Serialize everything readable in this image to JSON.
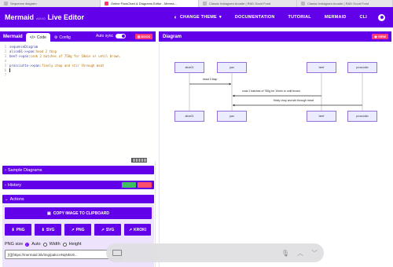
{
  "browser_tabs": [
    {
      "label": "Sequence diagram",
      "active": false
    },
    {
      "label": "Online FlowChart & Diagrams Editor - Merma...",
      "active": true
    },
    {
      "label": "Classic Instagram Arcade | RAD Good Fond",
      "active": false
    },
    {
      "label": "Classic Instagram Arcade | RAD Good Fond",
      "active": false
    }
  ],
  "header": {
    "brand": "Mermaid",
    "version": "v10.0.0",
    "brand_suffix": "Live Editor",
    "nav": [
      "CHANGE THEME",
      "DOCUMENTATION",
      "TUTORIAL",
      "MERMAID",
      "CLI"
    ]
  },
  "editor": {
    "title": "Mermaid",
    "tab_code": "Code",
    "tab_config": "Config",
    "auto_sync_label": "Auto sync",
    "docs_label": "DOCS",
    "lines": [
      {
        "num": "1",
        "kw": "sequenceDiagram",
        "text": ""
      },
      {
        "num": "2",
        "kw": "alice01->>pan:",
        "text": " head 2 tbsp"
      },
      {
        "num": "3",
        "kw": "beef->>pan:",
        "text": " cook 2 batches of 750g for 10min or until brown."
      },
      {
        "num": "4",
        "kw": "",
        "text": ""
      },
      {
        "num": "5",
        "kw": "prosciutto->>pan:",
        "text": " finely chop and stir through meat"
      },
      {
        "num": "6",
        "kw": "",
        "text": ""
      },
      {
        "num": "7",
        "kw": "",
        "text": ""
      }
    ]
  },
  "sections": {
    "samples": "Sample Diagrams",
    "history": "History",
    "actions": "Actions"
  },
  "actions": {
    "copy_image": "COPY IMAGE TO CLIPBOARD",
    "exports": [
      "PNG",
      "SVG",
      "PNG",
      "SVG",
      "KROKI"
    ],
    "png_size_label": "PNG size",
    "size_options": [
      "Auto",
      "Width",
      "Height"
    ],
    "selected_size": "Auto",
    "url": "[![](https://mermaid.ink/img/pako:eNqNkU9..."
  },
  "diagram": {
    "title": "Diagram",
    "view_label": "VIEW",
    "participants": [
      "alice01",
      "pan",
      "beef",
      "prosciutto"
    ],
    "messages": [
      {
        "from": "alice01",
        "to": "pan",
        "text": "head 2 tbsp"
      },
      {
        "from": "beef",
        "to": "pan",
        "text": "cook 2 batches of 750g for 10min or until brown."
      },
      {
        "from": "prosciutto",
        "to": "pan",
        "text": "finely chop and stir through meat"
      }
    ]
  },
  "colors": {
    "primary": "#6200ea",
    "accent": "#ff3670",
    "actor_fill": "#ececff",
    "actor_border": "#9370db"
  }
}
